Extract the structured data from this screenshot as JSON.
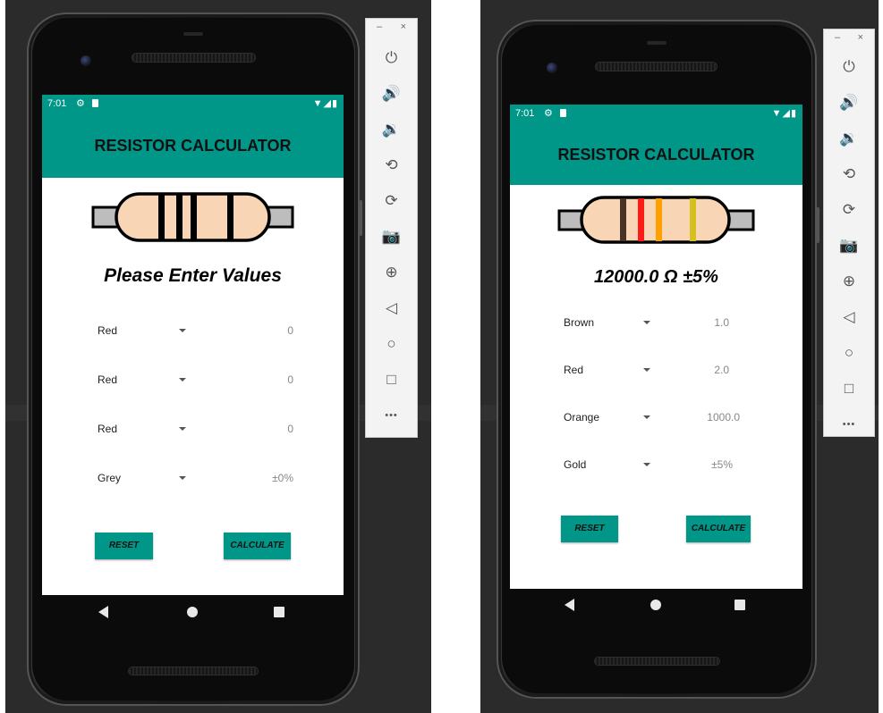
{
  "left": {
    "status_bar": {
      "time": "7:01"
    },
    "app_title": "RESISTOR CALCULATOR",
    "result_text": "Please Enter Values",
    "resistor_bands": [
      "#000000",
      "#000000",
      "#000000",
      "#000000"
    ],
    "rows": [
      {
        "color": "Red",
        "value": "0"
      },
      {
        "color": "Red",
        "value": "0"
      },
      {
        "color": "Red",
        "value": "0"
      },
      {
        "color": "Grey",
        "value": "±0%"
      }
    ],
    "reset_label": "RESET",
    "calculate_label": "CALCULATE"
  },
  "right": {
    "status_bar": {
      "time": "7:01"
    },
    "app_title": "RESISTOR CALCULATOR",
    "result_text": "12000.0 Ω  ±5%",
    "resistor_bands": [
      "#4a3326",
      "#ff1a1a",
      "#ffa000",
      "#d4c021"
    ],
    "rows": [
      {
        "color": "Brown",
        "value": "1.0"
      },
      {
        "color": "Red",
        "value": "2.0"
      },
      {
        "color": "Orange",
        "value": "1000.0"
      },
      {
        "color": "Gold",
        "value": "±5%"
      }
    ],
    "reset_label": "RESET",
    "calculate_label": "CALCULATE"
  },
  "emulator_toolbar": {
    "minimize": "–",
    "close": "×",
    "items": [
      {
        "icon": "power-icon",
        "glyph": "⏻"
      },
      {
        "icon": "volume-up-icon",
        "glyph": "🔊"
      },
      {
        "icon": "volume-down-icon",
        "glyph": "🔉"
      },
      {
        "icon": "rotate-left-icon",
        "glyph": "⟲"
      },
      {
        "icon": "rotate-right-icon",
        "glyph": "⟳"
      },
      {
        "icon": "camera-icon",
        "glyph": "📷"
      },
      {
        "icon": "zoom-icon",
        "glyph": "⊕"
      },
      {
        "icon": "back-icon",
        "glyph": "◁"
      },
      {
        "icon": "home-icon",
        "glyph": "○"
      },
      {
        "icon": "overview-icon",
        "glyph": "□"
      },
      {
        "icon": "more-icon",
        "glyph": "•••"
      }
    ]
  },
  "colors": {
    "accent": "#009688",
    "resistor_body": "#f8d5b5"
  }
}
